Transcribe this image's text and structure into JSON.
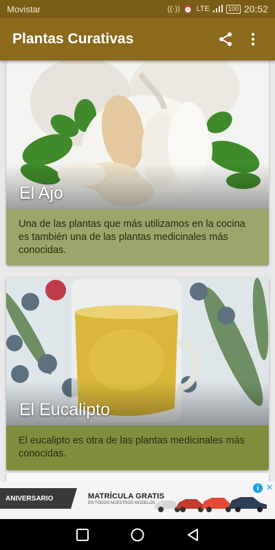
{
  "status_bar": {
    "carrier": "Movistar",
    "network": "LTE",
    "battery": "100",
    "time": "20:52"
  },
  "app_bar": {
    "title": "Plantas Curativas",
    "share_icon": "share-icon",
    "menu_icon": "more-vert-icon",
    "background": "#8b6a1c"
  },
  "cards": [
    {
      "title": "El Ajo",
      "description": "Una de las plantas que más utilizamos en la cocina es también una de las plantas medicinales más conocidas.",
      "color": "#9aa66a"
    },
    {
      "title": "El Eucalipto",
      "description": "El eucalipto es otra de las plantas medicinales más conocidas.",
      "color": "#7f8e3d"
    }
  ],
  "ad": {
    "badge": "ANIVERSARIO",
    "headline": "MATRÍCULA GRATIS",
    "subline": "EN TODOS NUESTROS MODELOS",
    "info_icon": "info-icon",
    "close_icon": "close-icon"
  },
  "nav_bar": {
    "recents_icon": "square-icon",
    "home_icon": "circle-icon",
    "back_icon": "triangle-back-icon"
  }
}
